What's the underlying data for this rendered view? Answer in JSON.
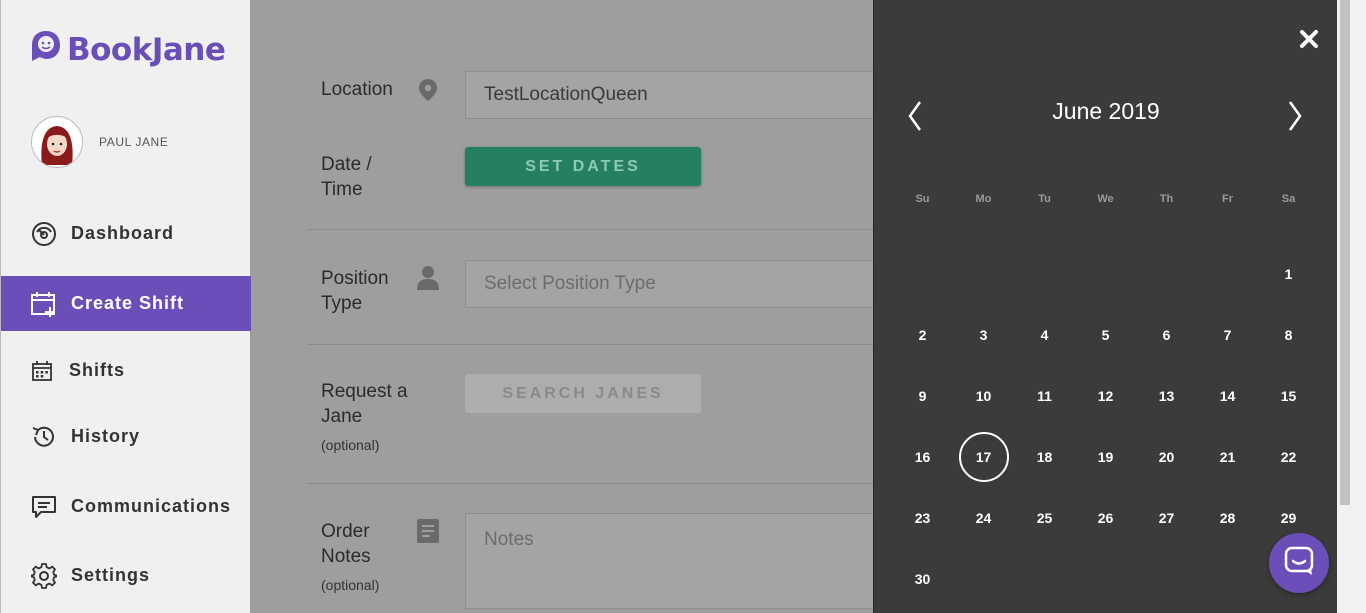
{
  "brand": {
    "name": "BookJane",
    "color": "#6b4eb8"
  },
  "user": {
    "name": "PAUL JANE"
  },
  "nav": {
    "dashboard": "Dashboard",
    "create_shift": "Create Shift",
    "shifts": "Shifts",
    "history": "History",
    "communications": "Communications",
    "settings": "Settings"
  },
  "form": {
    "location_label": "Location",
    "location_value": "TestLocationQueen",
    "date_label_1": "Date /",
    "date_label_2": "Time",
    "set_dates": "SET DATES",
    "position_label_1": "Position",
    "position_label_2": "Type",
    "position_placeholder": "Select Position Type",
    "request_label_1": "Request a",
    "request_label_2": "Jane",
    "request_optional": "(optional)",
    "search_janes": "SEARCH JANES",
    "notes_label_1": "Order",
    "notes_label_2": "Notes",
    "notes_optional": "(optional)",
    "notes_placeholder": "Notes"
  },
  "calendar": {
    "title": "June 2019",
    "weekdays": [
      "Su",
      "Mo",
      "Tu",
      "We",
      "Th",
      "Fr",
      "Sa"
    ],
    "leading_blanks": 6,
    "days": [
      1,
      2,
      3,
      4,
      5,
      6,
      7,
      8,
      9,
      10,
      11,
      12,
      13,
      14,
      15,
      16,
      17,
      18,
      19,
      20,
      21,
      22,
      23,
      24,
      25,
      26,
      27,
      28,
      29,
      30
    ],
    "selected_day": 17
  }
}
